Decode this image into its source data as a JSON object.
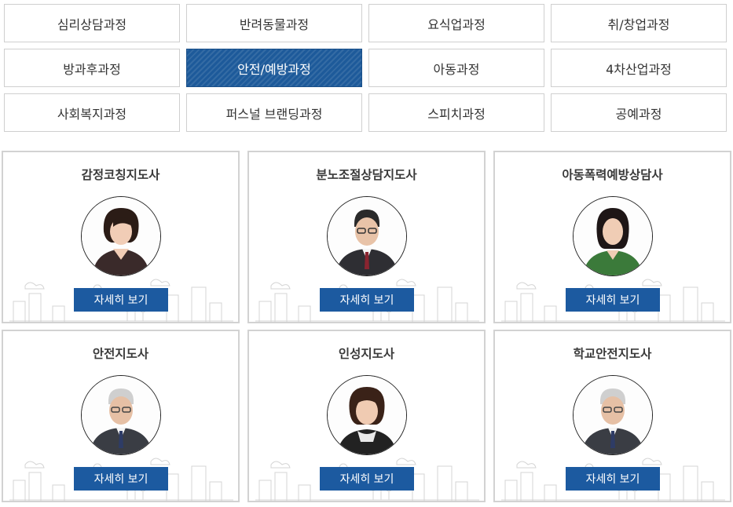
{
  "course_tabs": [
    {
      "label": "심리상담과정",
      "active": false
    },
    {
      "label": "반려동물과정",
      "active": false
    },
    {
      "label": "요식업과정",
      "active": false
    },
    {
      "label": "취/창업과정",
      "active": false
    },
    {
      "label": "방과후과정",
      "active": false
    },
    {
      "label": "안전/예방과정",
      "active": true
    },
    {
      "label": "아동과정",
      "active": false
    },
    {
      "label": "4차산업과정",
      "active": false
    },
    {
      "label": "사회복지과정",
      "active": false
    },
    {
      "label": "퍼스널 브랜딩과정",
      "active": false
    },
    {
      "label": "스피치과정",
      "active": false
    },
    {
      "label": "공예과정",
      "active": false
    }
  ],
  "courses": [
    {
      "title": "감정코칭지도사",
      "button_label": "자세히 보기",
      "photo_icon": "woman-portrait"
    },
    {
      "title": "분노조절상담지도사",
      "button_label": "자세히 보기",
      "photo_icon": "man-glasses-portrait"
    },
    {
      "title": "아동폭력예방상담사",
      "button_label": "자세히 보기",
      "photo_icon": "woman-portrait"
    },
    {
      "title": "안전지도사",
      "button_label": "자세히 보기",
      "photo_icon": "elder-man-portrait"
    },
    {
      "title": "인성지도사",
      "button_label": "자세히 보기",
      "photo_icon": "woman-portrait"
    },
    {
      "title": "학교안전지도사",
      "button_label": "자세히 보기",
      "photo_icon": "elder-man-portrait"
    }
  ],
  "colors": {
    "active_tab": "#1d5a9a",
    "button": "#1c5aa0",
    "border": "#d2d2d2"
  }
}
